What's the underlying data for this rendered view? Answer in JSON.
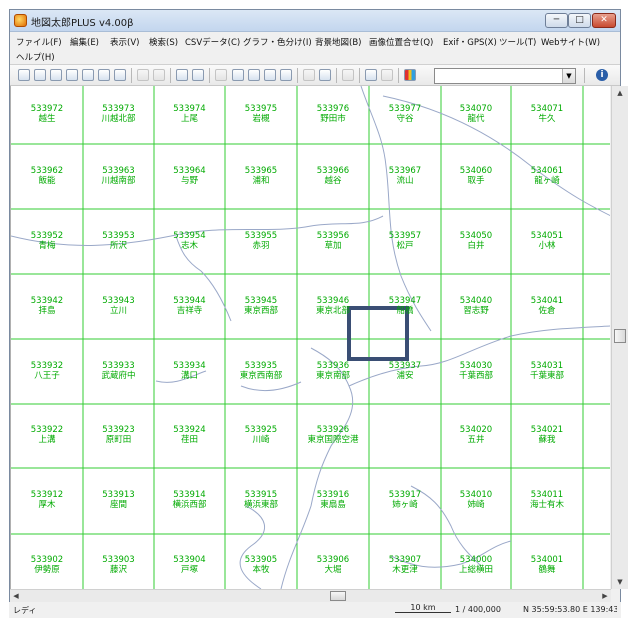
{
  "window": {
    "title": "地図太郎PLUS v4.00β",
    "min_label": "─",
    "max_label": "□",
    "close_label": "✕"
  },
  "menu": [
    "ファイル(F)",
    "編集(E)",
    "表示(V)",
    "検索(S)",
    "CSVデータ(C)",
    "グラフ・色分け(I)",
    "背景地図(B)",
    "画像位置合せ(Q)",
    "Exif・GPS(X)",
    "ツール(T)",
    "Webサイト(W)",
    "ヘルプ(H)"
  ],
  "toolbar": {
    "icons": [
      "new-file-icon",
      "open-folder-icon",
      "save-icon",
      "copy-icon",
      "paste-icon",
      "print-icon",
      "print-preview-icon",
      "undo-icon",
      "redo-icon",
      "add-point-icon",
      "camera-icon",
      "edit-icon",
      "zoom-in-icon",
      "zoom-out-icon",
      "zoom-fit-icon",
      "zoom-all-icon",
      "binoculars-icon",
      "pan-hand-icon",
      "layer-icon",
      "attribute-icon",
      "table-icon",
      "chart-icon",
      "info-icon",
      "back-icon"
    ],
    "combo_value": "",
    "combo_arrow": "▼",
    "info_label": "i"
  },
  "grid": {
    "rows": [
      [
        [
          "533972",
          "越生"
        ],
        [
          "533973",
          "川越北部"
        ],
        [
          "533974",
          "上尾"
        ],
        [
          "533975",
          "岩槻"
        ],
        [
          "533976",
          "野田市"
        ],
        [
          "533977",
          "守谷"
        ],
        [
          "534070",
          "龍代"
        ],
        [
          "534071",
          "牛久"
        ]
      ],
      [
        [
          "533962",
          "飯能"
        ],
        [
          "533963",
          "川越南部"
        ],
        [
          "533964",
          "与野"
        ],
        [
          "533965",
          "浦和"
        ],
        [
          "533966",
          "越谷"
        ],
        [
          "533967",
          "流山"
        ],
        [
          "534060",
          "取手"
        ],
        [
          "534061",
          "龍ヶ崎"
        ]
      ],
      [
        [
          "533952",
          "青梅"
        ],
        [
          "533953",
          "所沢"
        ],
        [
          "533954",
          "志木"
        ],
        [
          "533955",
          "赤羽"
        ],
        [
          "533956",
          "草加"
        ],
        [
          "533957",
          "松戸"
        ],
        [
          "534050",
          "白井"
        ],
        [
          "534051",
          "小林"
        ]
      ],
      [
        [
          "533942",
          "拝島"
        ],
        [
          "533943",
          "立川"
        ],
        [
          "533944",
          "吉祥寺"
        ],
        [
          "533945",
          "東京西部"
        ],
        [
          "533946",
          "東京北部"
        ],
        [
          "533947",
          "船橋"
        ],
        [
          "534040",
          "習志野"
        ],
        [
          "534041",
          "佐倉"
        ]
      ],
      [
        [
          "533932",
          "八王子"
        ],
        [
          "533933",
          "武蔵府中"
        ],
        [
          "533934",
          "溝口"
        ],
        [
          "533935",
          "東京西南部"
        ],
        [
          "533936",
          "東京南部"
        ],
        [
          "533937",
          "浦安"
        ],
        [
          "534030",
          "千葉西部"
        ],
        [
          "534031",
          "千葉東部"
        ]
      ],
      [
        [
          "533922",
          "上溝"
        ],
        [
          "533923",
          "原町田"
        ],
        [
          "533924",
          "荏田"
        ],
        [
          "533925",
          "川崎"
        ],
        [
          "533926",
          "東京国際空港"
        ],
        [
          "",
          ""
        ],
        [
          "534020",
          "五井"
        ],
        [
          "534021",
          "蘇我"
        ]
      ],
      [
        [
          "533912",
          "厚木"
        ],
        [
          "533913",
          "座間"
        ],
        [
          "533914",
          "横浜西部"
        ],
        [
          "533915",
          "横浜東部"
        ],
        [
          "533916",
          "東扇島"
        ],
        [
          "533917",
          "姉ヶ崎"
        ],
        [
          "534010",
          "姉崎"
        ],
        [
          "534011",
          "海士有木"
        ]
      ],
      [
        [
          "533902",
          "伊勢原"
        ],
        [
          "533903",
          "藤沢"
        ],
        [
          "533904",
          "戸塚"
        ],
        [
          "533905",
          "本牧"
        ],
        [
          "533906",
          "大堀"
        ],
        [
          "533907",
          "木更津"
        ],
        [
          "534000",
          "上総横田"
        ],
        [
          "534001",
          "鶴舞"
        ]
      ]
    ],
    "line_color": "#33cc33",
    "text_color": "#00aa00",
    "coast_color": "#9aa8c8",
    "selection_color": "#3a4e74"
  },
  "scroll": {
    "up": "▲",
    "down": "▼",
    "left": "◀",
    "right": "▶"
  },
  "status": {
    "ready": "レディ",
    "scale_label": "10 km",
    "scale_ratio": "1 / 400,000",
    "coords": "N 35:59:53.80  E 139:43:53.56"
  }
}
